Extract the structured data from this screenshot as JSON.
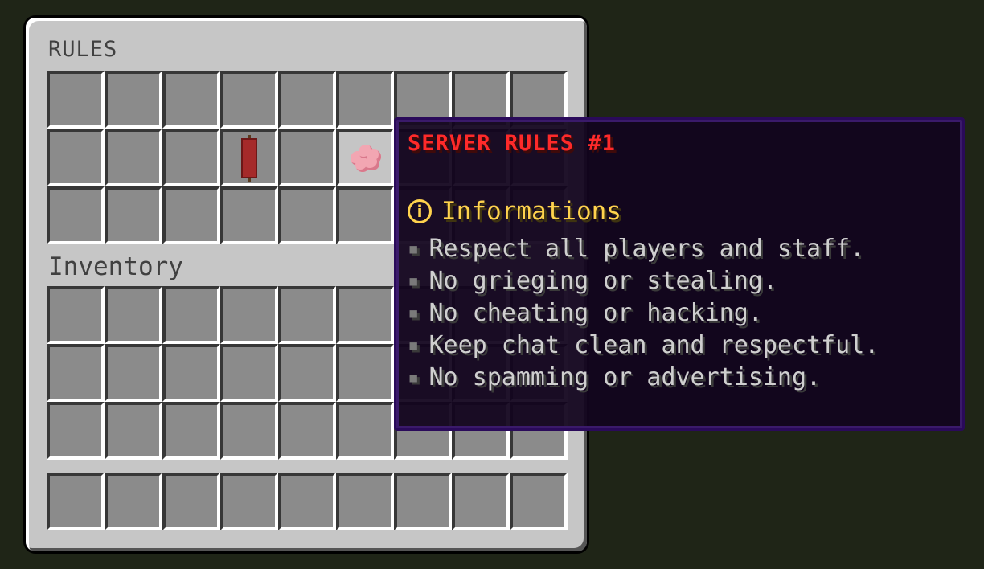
{
  "chest": {
    "title": "RULES",
    "rows": 3,
    "columns": 9,
    "items": [
      {
        "row": 1,
        "col": 3,
        "icon": "red-banner-icon"
      },
      {
        "row": 1,
        "col": 5,
        "icon": "brain-coral-icon",
        "hovered": true
      }
    ]
  },
  "inventory": {
    "title": "Inventory",
    "rows": 3,
    "columns": 9,
    "hotbar_slots": 9
  },
  "tooltip": {
    "title": "SERVER RULES #1",
    "title_color": "#ff2a2a",
    "section_icon": "info-icon",
    "section_icon_glyph": "i",
    "section_label": "Informations",
    "section_color": "#ffd34d",
    "bullet": "▪",
    "rules": [
      "Respect all players and staff.",
      "No grieging or stealing.",
      "No cheating or hacking.",
      "Keep chat clean and respectful.",
      "No spamming or advertising."
    ]
  }
}
